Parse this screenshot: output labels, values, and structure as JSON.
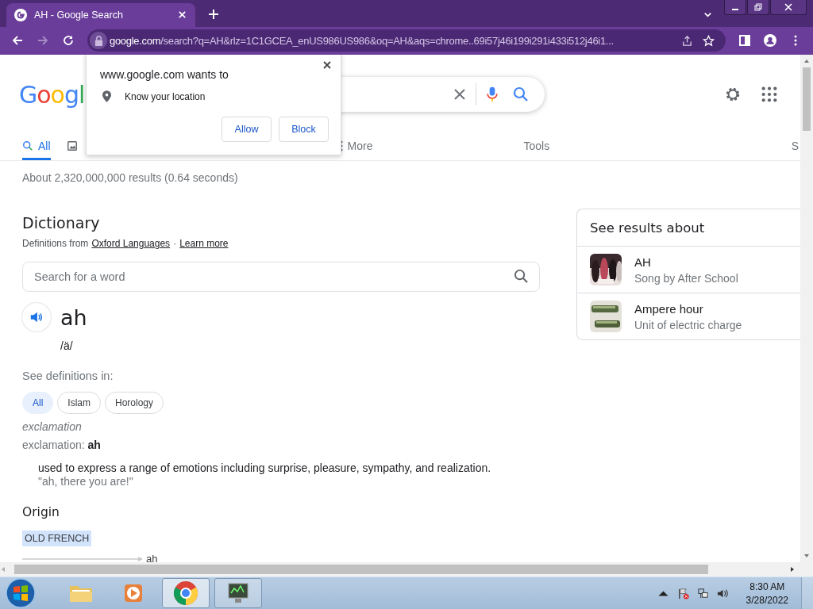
{
  "browser": {
    "tab_title": "AH - Google Search",
    "url_host": "google.com",
    "url_path": "/search?q=AH&rlz=1C1GCEA_enUS986US986&oq=AH&aqs=chrome..69i57j46i199i291i433i512j46i1..."
  },
  "permission_popup": {
    "title": "www.google.com wants to",
    "permission": "Know your location",
    "buttons": [
      "Allow",
      "Block"
    ]
  },
  "google": {
    "logo": "Googl",
    "nav_tabs": [
      {
        "kind": "search",
        "label": "All",
        "selected": true
      },
      {
        "kind": "images",
        "selected": false
      },
      {
        "kind": "more",
        "label": "More",
        "selected": false
      }
    ],
    "tools": "Tools",
    "nav_cut": "S",
    "results_stats": "About 2,320,000,000 results (0.64 seconds)"
  },
  "dictionary": {
    "title": "Dictionary",
    "source_prefix": "Definitions from",
    "source_link": "Oxford Languages",
    "separator": "·",
    "learn_more": "Learn more",
    "search_placeholder": "Search for a word",
    "word": "ah",
    "phonetic": "/ä/",
    "see_in": "See definitions in:",
    "filters": [
      {
        "label": "All",
        "selected": true
      },
      {
        "label": "Islam",
        "selected": false
      },
      {
        "label": "Horology",
        "selected": false
      }
    ],
    "part_of_speech": "exclamation",
    "pos_line": "exclamation: **ah**",
    "definition": "used to express a range of emotions including surprise, pleasure, sympathy, and realization.",
    "example": "\"ah, there you are!\"",
    "origin_title": "Origin",
    "origin_tag": "OLD FRENCH",
    "origin_word": "ah"
  },
  "side_panel": {
    "title": "See results about",
    "items": [
      {
        "title": "AH",
        "subtitle": "Song by After School",
        "kind": "picture"
      },
      {
        "title": "Ampere hour",
        "subtitle": "Unit of electric charge",
        "kind": "picture"
      }
    ]
  },
  "taskbar": {
    "apps": [
      {
        "kind": "folder",
        "open": false,
        "selected": false
      },
      {
        "kind": "media",
        "open": false,
        "selected": false
      },
      {
        "kind": "chrome",
        "open": true,
        "selected": true
      },
      {
        "kind": "monitor",
        "open": true,
        "selected": false
      }
    ],
    "time": "8:30 AM",
    "date": "3/28/2022"
  }
}
